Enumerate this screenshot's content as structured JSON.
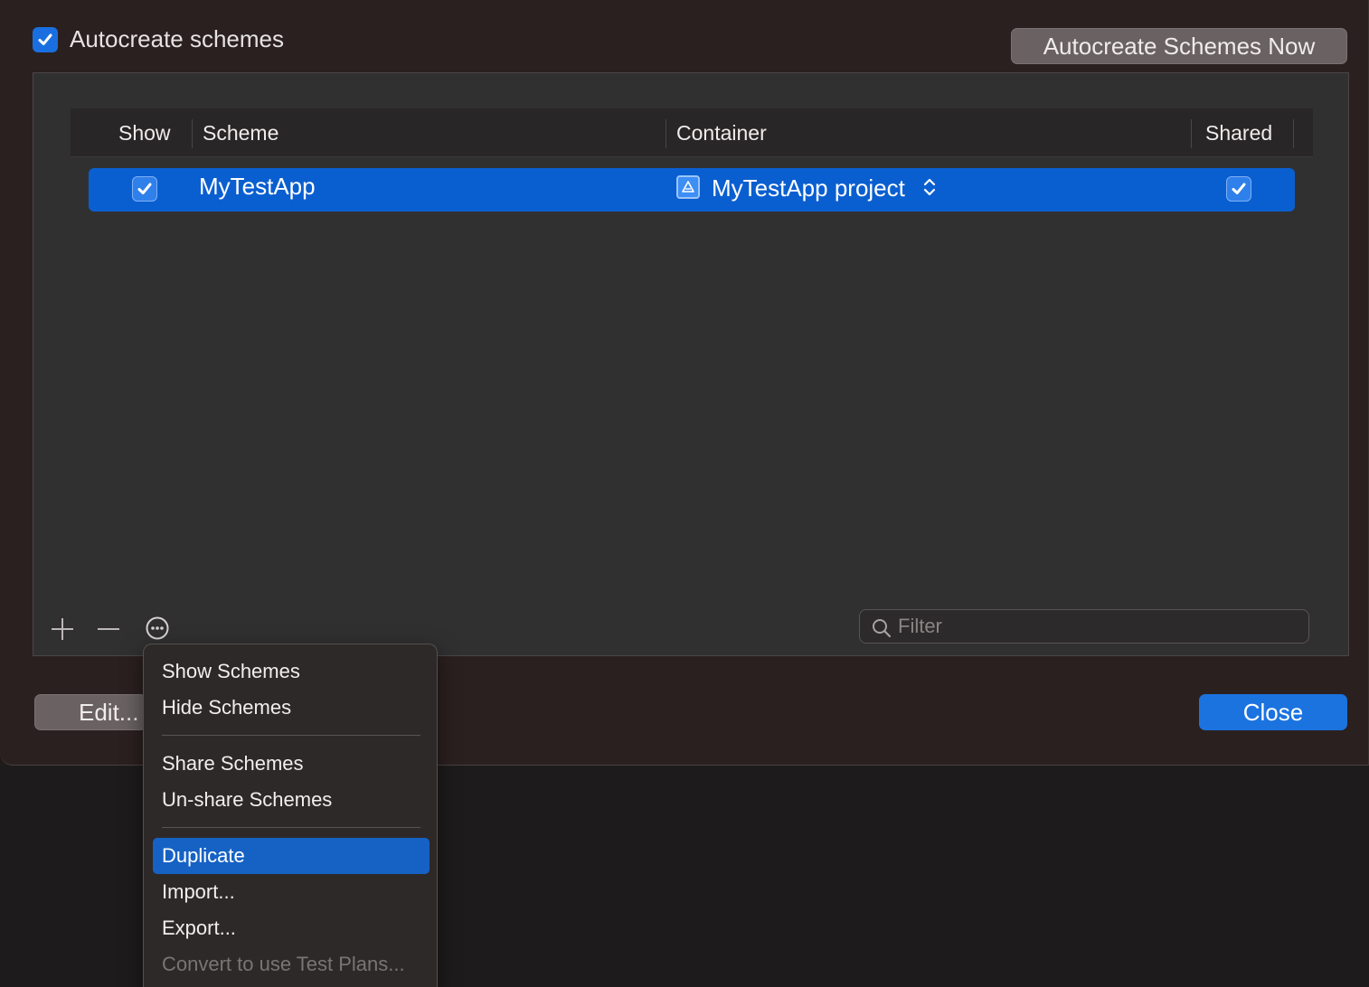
{
  "autocreate": {
    "label": "Autocreate schemes",
    "checked": true
  },
  "buttons": {
    "autocreate_now": "Autocreate Schemes Now",
    "edit": "Edit...",
    "close": "Close"
  },
  "table": {
    "headers": {
      "show": "Show",
      "scheme": "Scheme",
      "container": "Container",
      "shared": "Shared"
    },
    "rows": [
      {
        "show": true,
        "scheme": "MyTestApp",
        "container": "MyTestApp project",
        "shared": true
      }
    ]
  },
  "filter": {
    "placeholder": "Filter",
    "value": ""
  },
  "menu": {
    "items": [
      {
        "label": "Show Schemes"
      },
      {
        "label": "Hide Schemes"
      },
      {
        "label": "Share Schemes"
      },
      {
        "label": "Un-share Schemes"
      },
      {
        "label": "Duplicate",
        "selected": true
      },
      {
        "label": "Import..."
      },
      {
        "label": "Export..."
      },
      {
        "label": "Convert to use Test Plans...",
        "disabled": true
      }
    ]
  },
  "colors": {
    "accent": "#1b73e0",
    "row_selected": "#0a5fd0",
    "menu_highlight": "#1662c4"
  }
}
